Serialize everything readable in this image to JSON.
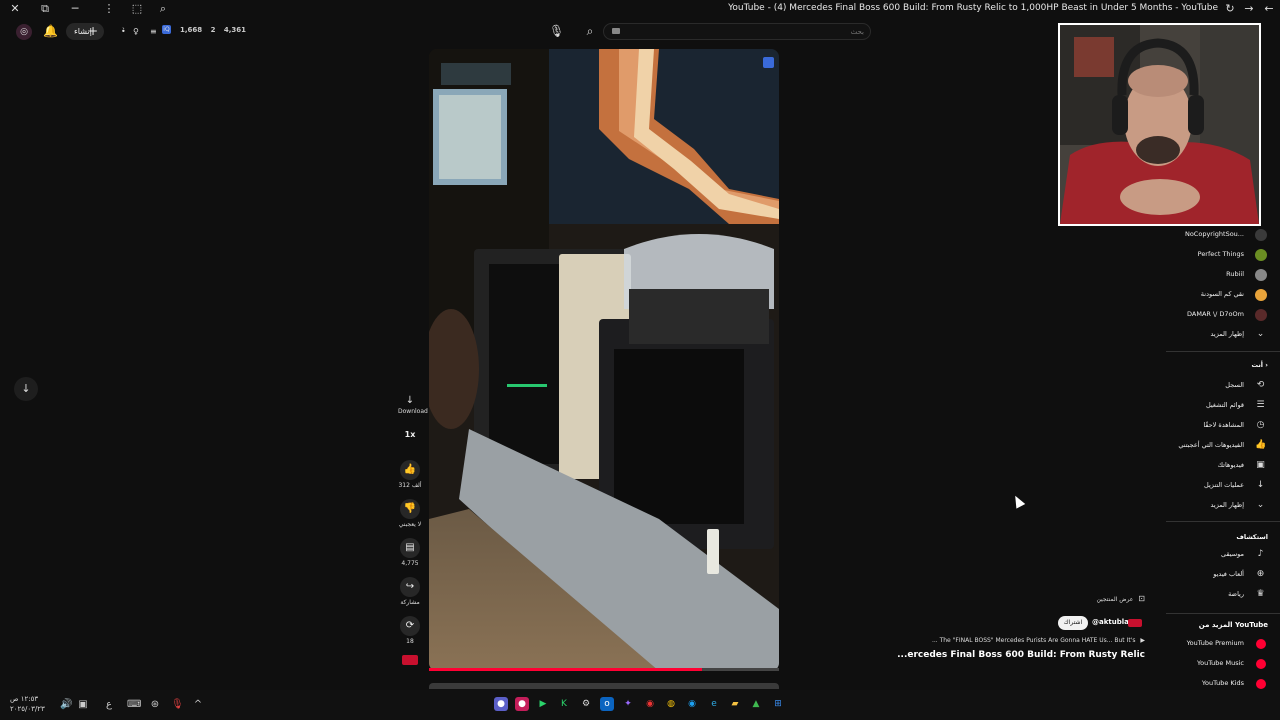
{
  "window": {
    "title": "YouTube - (4) Mercedes Final Boss 600 Build: From Rusty Relic to 1,000HP Beast in Under 5 Months - YouTube"
  },
  "topbar": {
    "create_label": "إنشاء",
    "stats": [
      "1,668",
      "2",
      "4,361"
    ],
    "search_placeholder": "بحث"
  },
  "player": {
    "progress": 0.78
  },
  "actions": {
    "download_label": "Download",
    "speed_label": "1x",
    "like_count": "312 ألف",
    "dislike_label": "لا يعجبني",
    "comment_count": "4,775",
    "share_label": "مشاركة",
    "remix_count": "18"
  },
  "video": {
    "view_products": "عرض المنتجين",
    "subscribe": "اشتراك",
    "channel_handle": "@aktubla",
    "description": "... The \"FINAL BOSS\" Mercedes Purists Are Gonna HATE Us... But It's",
    "title": "...ercedes Final Boss 600 Build: From Rusty Relic"
  },
  "sidebar": {
    "subscriptions": [
      {
        "label": "NoCopyrightSou...",
        "color": "#3a3a3a"
      },
      {
        "label": "Perfect Things",
        "color": "#6b8e23"
      },
      {
        "label": "Rubiil",
        "color": "#888888"
      },
      {
        "label": "نقي كم السودنة",
        "color": "#e8a33a"
      },
      {
        "label": "DAMAR \\/ D7oOm",
        "color": "#5a2a2a"
      }
    ],
    "show_more_1": "إظهار المزيد",
    "you_header": "أنت",
    "you_items": [
      {
        "label": "السجل",
        "icon": "history-icon",
        "glyph": "⟲"
      },
      {
        "label": "قوائم التشغيل",
        "icon": "playlist-icon",
        "glyph": "☰"
      },
      {
        "label": "المشاهدة لاحقًا",
        "icon": "clock-icon",
        "glyph": "◷"
      },
      {
        "label": "الفيديوهات التي أعجبتني",
        "icon": "thumbs-up-icon",
        "glyph": "👍"
      },
      {
        "label": "فيديوهاتك",
        "icon": "video-icon",
        "glyph": "▶"
      },
      {
        "label": "عمليات التنزيل",
        "icon": "download-icon",
        "glyph": "↓"
      }
    ],
    "show_more_2": "إظهار المزيد",
    "explore_header": "استكشاف",
    "explore_items": [
      {
        "label": "موسيقى",
        "icon": "music-icon",
        "glyph": "♪"
      },
      {
        "label": "ألعاب فيديو",
        "icon": "gamepad-icon",
        "glyph": "⊕"
      },
      {
        "label": "رياضة",
        "icon": "trophy-icon",
        "glyph": "🏆"
      }
    ],
    "more_header": "المزيد من YouTube",
    "more_items": [
      {
        "label": "YouTube Premium"
      },
      {
        "label": "YouTube Music"
      },
      {
        "label": "YouTube Kids"
      }
    ]
  },
  "taskbar": {
    "time": "١٢:٥٣ ص",
    "date": "٢٠٢٥/٠٣/٢٣"
  },
  "colors": {
    "background": "#0f0f0f",
    "accent_red": "#ff0033",
    "surface": "#272727"
  }
}
